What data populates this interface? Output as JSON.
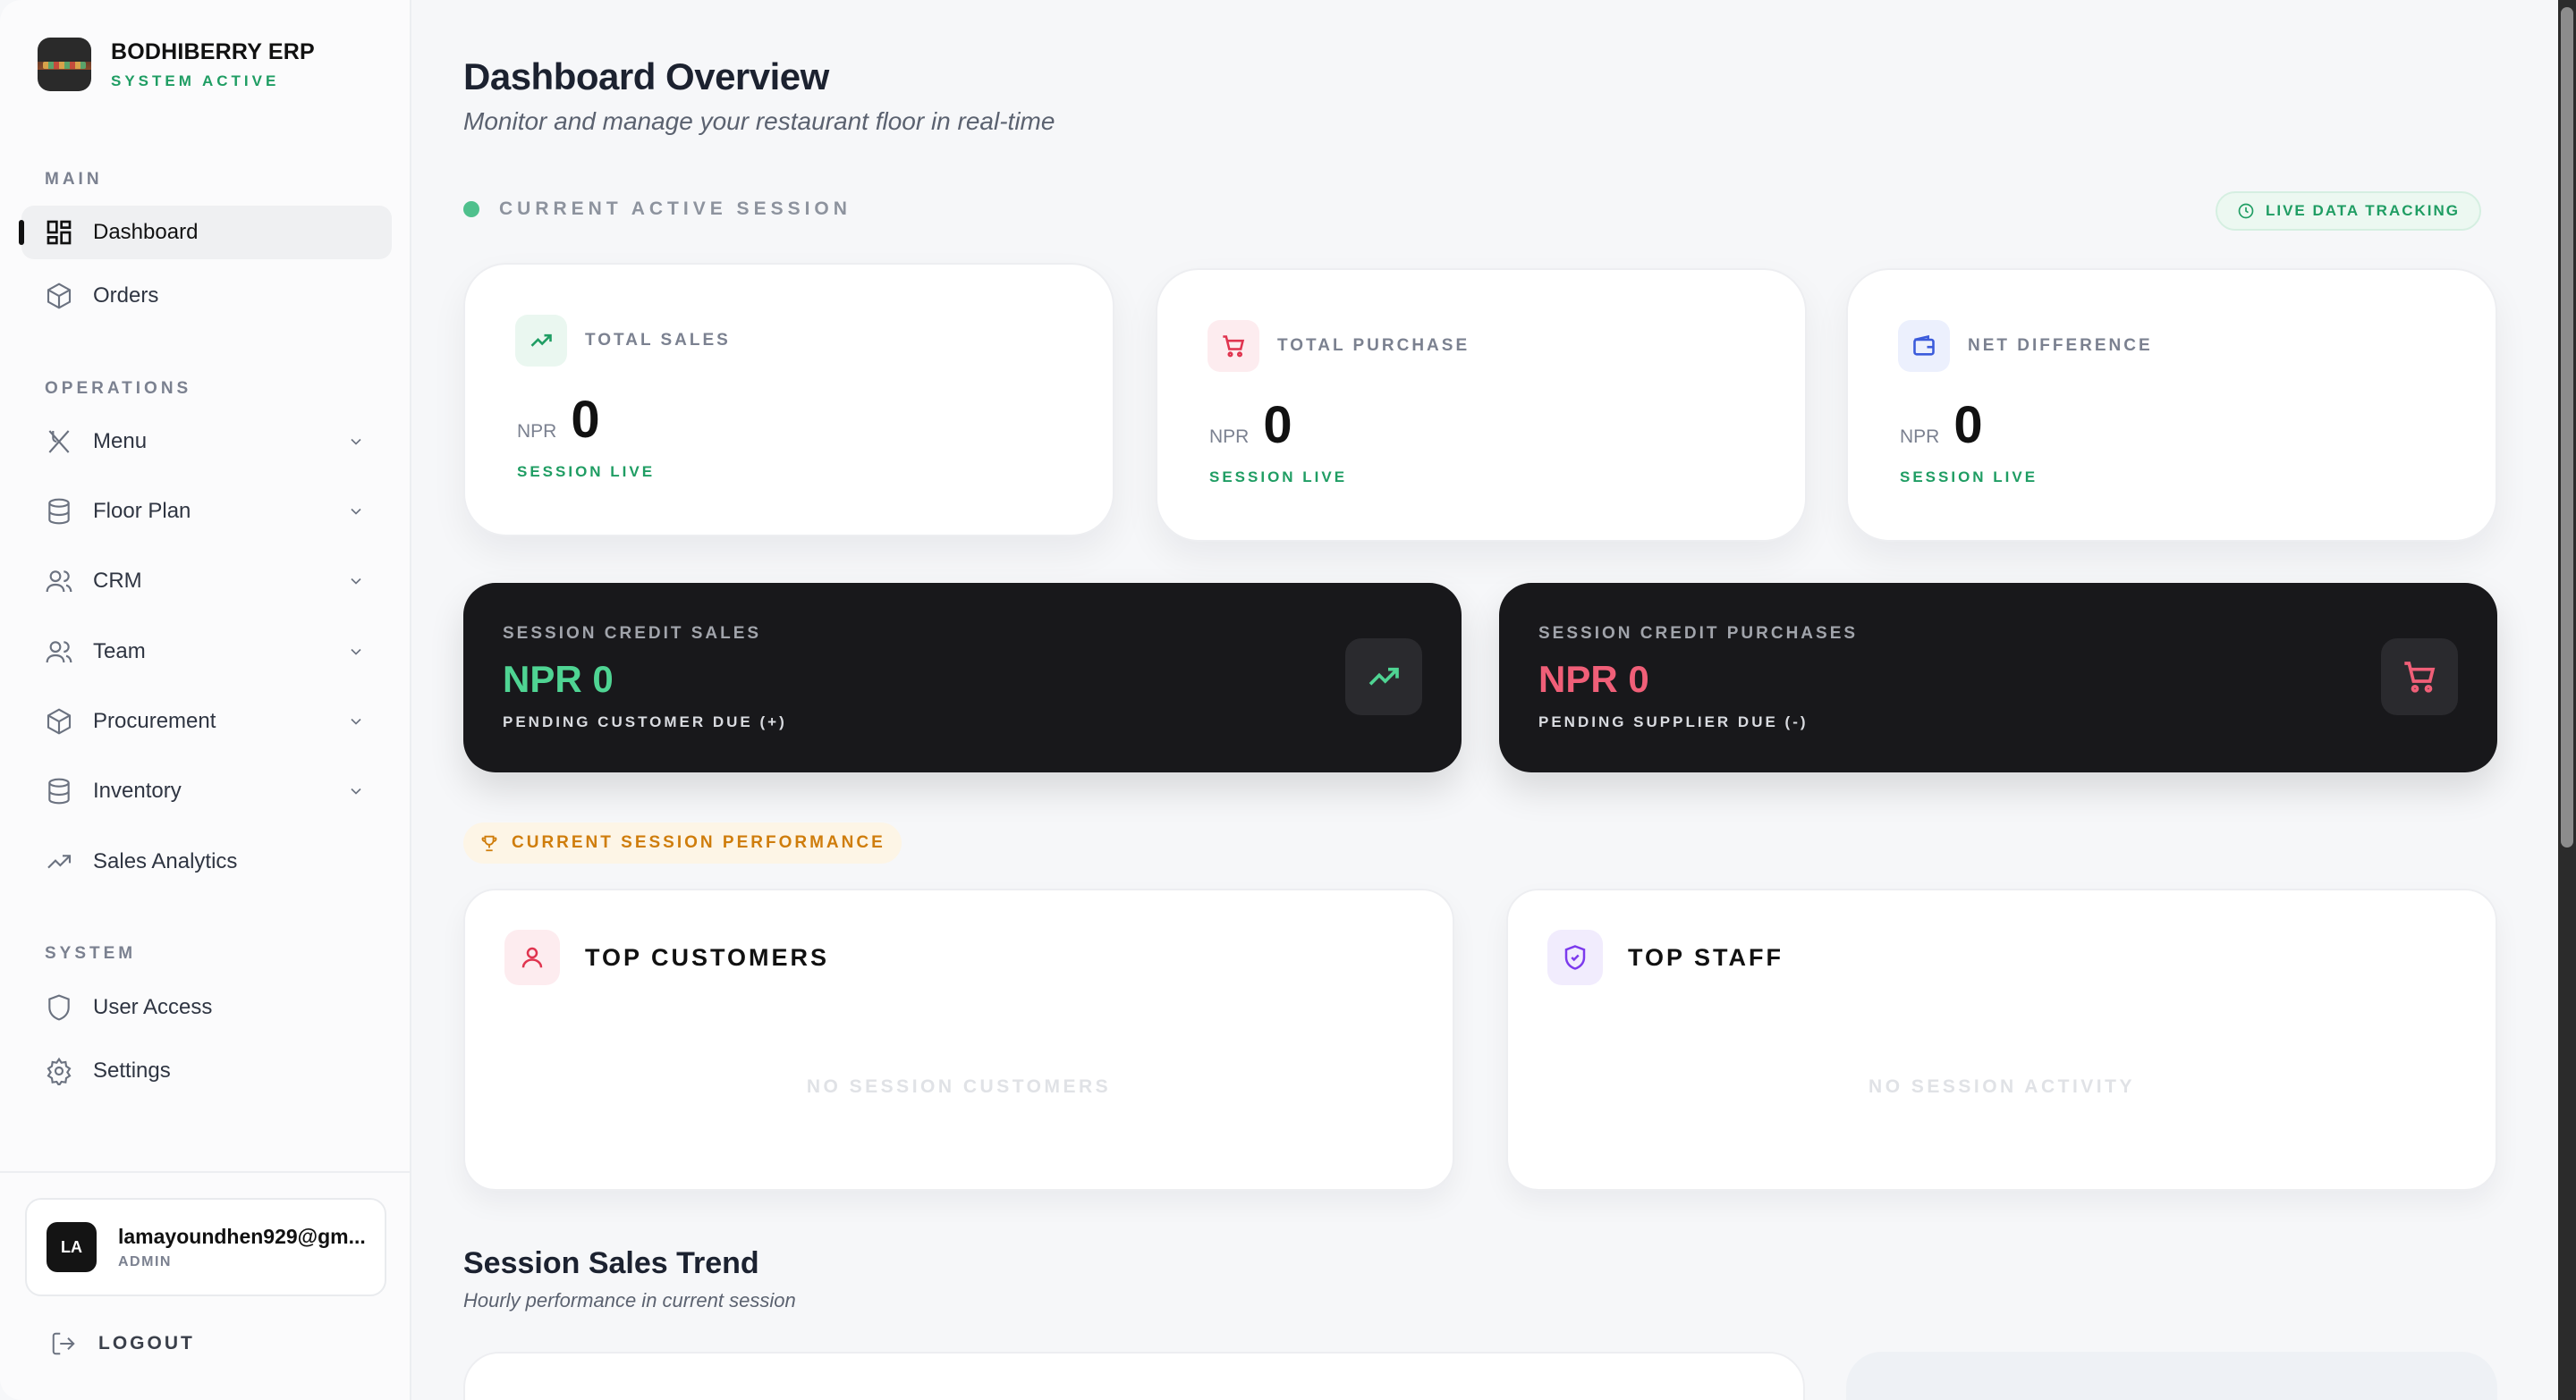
{
  "brand": {
    "name": "BODHIBERRY ERP",
    "status": "SYSTEM ACTIVE"
  },
  "sidebar": {
    "sections": {
      "main": "MAIN",
      "operations": "OPERATIONS",
      "system": "SYSTEM"
    },
    "items": [
      {
        "label": "Dashboard",
        "icon": "grid-icon",
        "active": true
      },
      {
        "label": "Orders",
        "icon": "package-icon"
      },
      {
        "label": "Menu",
        "icon": "utensils-icon",
        "expandable": true
      },
      {
        "label": "Floor Plan",
        "icon": "database-icon",
        "expandable": true
      },
      {
        "label": "CRM",
        "icon": "users-icon",
        "expandable": true
      },
      {
        "label": "Team",
        "icon": "users-icon",
        "expandable": true
      },
      {
        "label": "Procurement",
        "icon": "package-icon",
        "expandable": true
      },
      {
        "label": "Inventory",
        "icon": "database-icon",
        "expandable": true
      },
      {
        "label": "Sales Analytics",
        "icon": "trending-up-icon"
      },
      {
        "label": "User Access",
        "icon": "shield-icon"
      },
      {
        "label": "Settings",
        "icon": "gear-icon"
      }
    ]
  },
  "user": {
    "initials": "LA",
    "email": "lamayoundhen929@gm...",
    "role": "ADMIN"
  },
  "logout_label": "LOGOUT",
  "header": {
    "title": "Dashboard Overview",
    "subtitle": "Monitor and manage your restaurant floor in real-time"
  },
  "session": {
    "label": "CURRENT ACTIVE SESSION",
    "live_label": "LIVE DATA TRACKING"
  },
  "stats": [
    {
      "label": "TOTAL SALES",
      "currency": "NPR",
      "value": "0",
      "footer": "SESSION LIVE",
      "accent": "#1f9d63"
    },
    {
      "label": "TOTAL PURCHASE",
      "currency": "NPR",
      "value": "0",
      "footer": "SESSION LIVE",
      "accent": "#e0344f"
    },
    {
      "label": "NET DIFFERENCE",
      "currency": "NPR",
      "value": "0",
      "footer": "SESSION LIVE",
      "accent": "#3b5bdb"
    }
  ],
  "credits": [
    {
      "label": "SESSION CREDIT SALES",
      "value": "NPR 0",
      "sub": "PENDING CUSTOMER DUE (+)",
      "color": "#4fd493"
    },
    {
      "label": "SESSION CREDIT PURCHASES",
      "value": "NPR 0",
      "sub": "PENDING SUPPLIER DUE (-)",
      "color": "#f05f78"
    }
  ],
  "performance_label": "CURRENT SESSION PERFORMANCE",
  "top_customers": {
    "title": "TOP CUSTOMERS",
    "empty": "NO SESSION CUSTOMERS"
  },
  "top_staff": {
    "title": "TOP STAFF",
    "empty": "NO SESSION ACTIVITY"
  },
  "trend": {
    "title": "Session Sales Trend",
    "subtitle": "Hourly performance in current session"
  }
}
